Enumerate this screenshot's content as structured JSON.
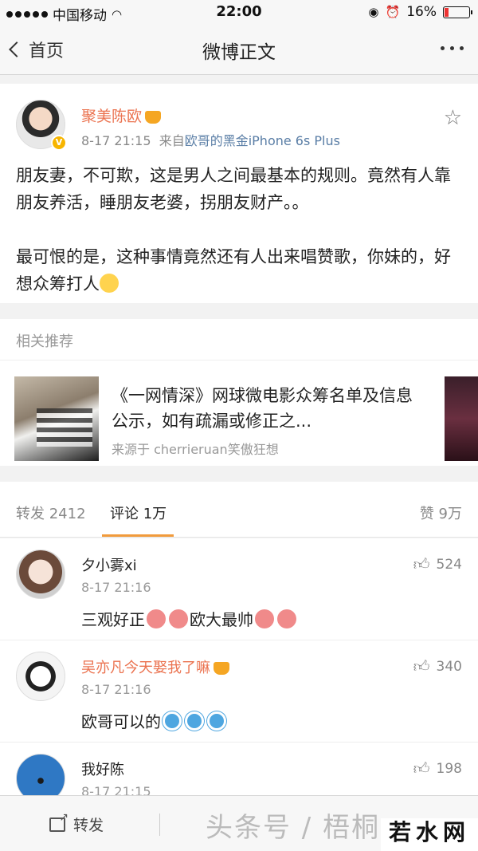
{
  "status_bar": {
    "carrier": "中国移动",
    "time": "22:00",
    "battery_pct": "16%",
    "battery_level": 0.16
  },
  "nav": {
    "back_label": "首页",
    "title": "微博正文"
  },
  "post": {
    "author": "聚美陈欧",
    "time": "8-17 21:15",
    "source_prefix": "来自",
    "source": "欧哥的黑金iPhone 6s Plus",
    "text_p1": "朋友妻，不可欺，这是男人之间最基本的规则。竟然有人靠朋友养活，睡朋友老婆，拐朋友财产。。",
    "text_p2": "最可恨的是，这种事情竟然还有人出来唱赞歌，你妹的，好想众筹打人"
  },
  "related": {
    "heading": "相关推荐",
    "title": "《一网情深》网球微电影众筹名单及信息公示，如有疏漏或修正之...",
    "source": "来源于 cherrieruan笑傲狂想"
  },
  "tabs": {
    "repost": "转发 2412",
    "comments": "评论 1万",
    "likes": "赞 9万"
  },
  "comments": [
    {
      "name": "夕小雾xi",
      "time": "8-17 21:16",
      "text": "三观好正",
      "text2": "欧大最帅",
      "likes": "524"
    },
    {
      "name": "吴亦凡今天娶我了嘛",
      "time": "8-17 21:16",
      "text": "欧哥可以的",
      "likes": "340"
    },
    {
      "name": "我好陈",
      "time": "8-17 21:15",
      "likes": "198"
    }
  ],
  "bottom": {
    "repost_label": "转发",
    "watermark": "头条号 / 梧桐",
    "site_logo": "若水网"
  },
  "colors": {
    "accent_orange": "#eb7350",
    "tab_underline": "#f19b3c",
    "link_blue": "#5a7ea6"
  },
  "icons": [
    "wifi-icon",
    "lock-rotation-icon",
    "alarm-icon",
    "battery-icon",
    "chevron-left-icon",
    "more-icon",
    "star-icon",
    "crown-icon",
    "thumb-up-icon",
    "share-icon"
  ]
}
